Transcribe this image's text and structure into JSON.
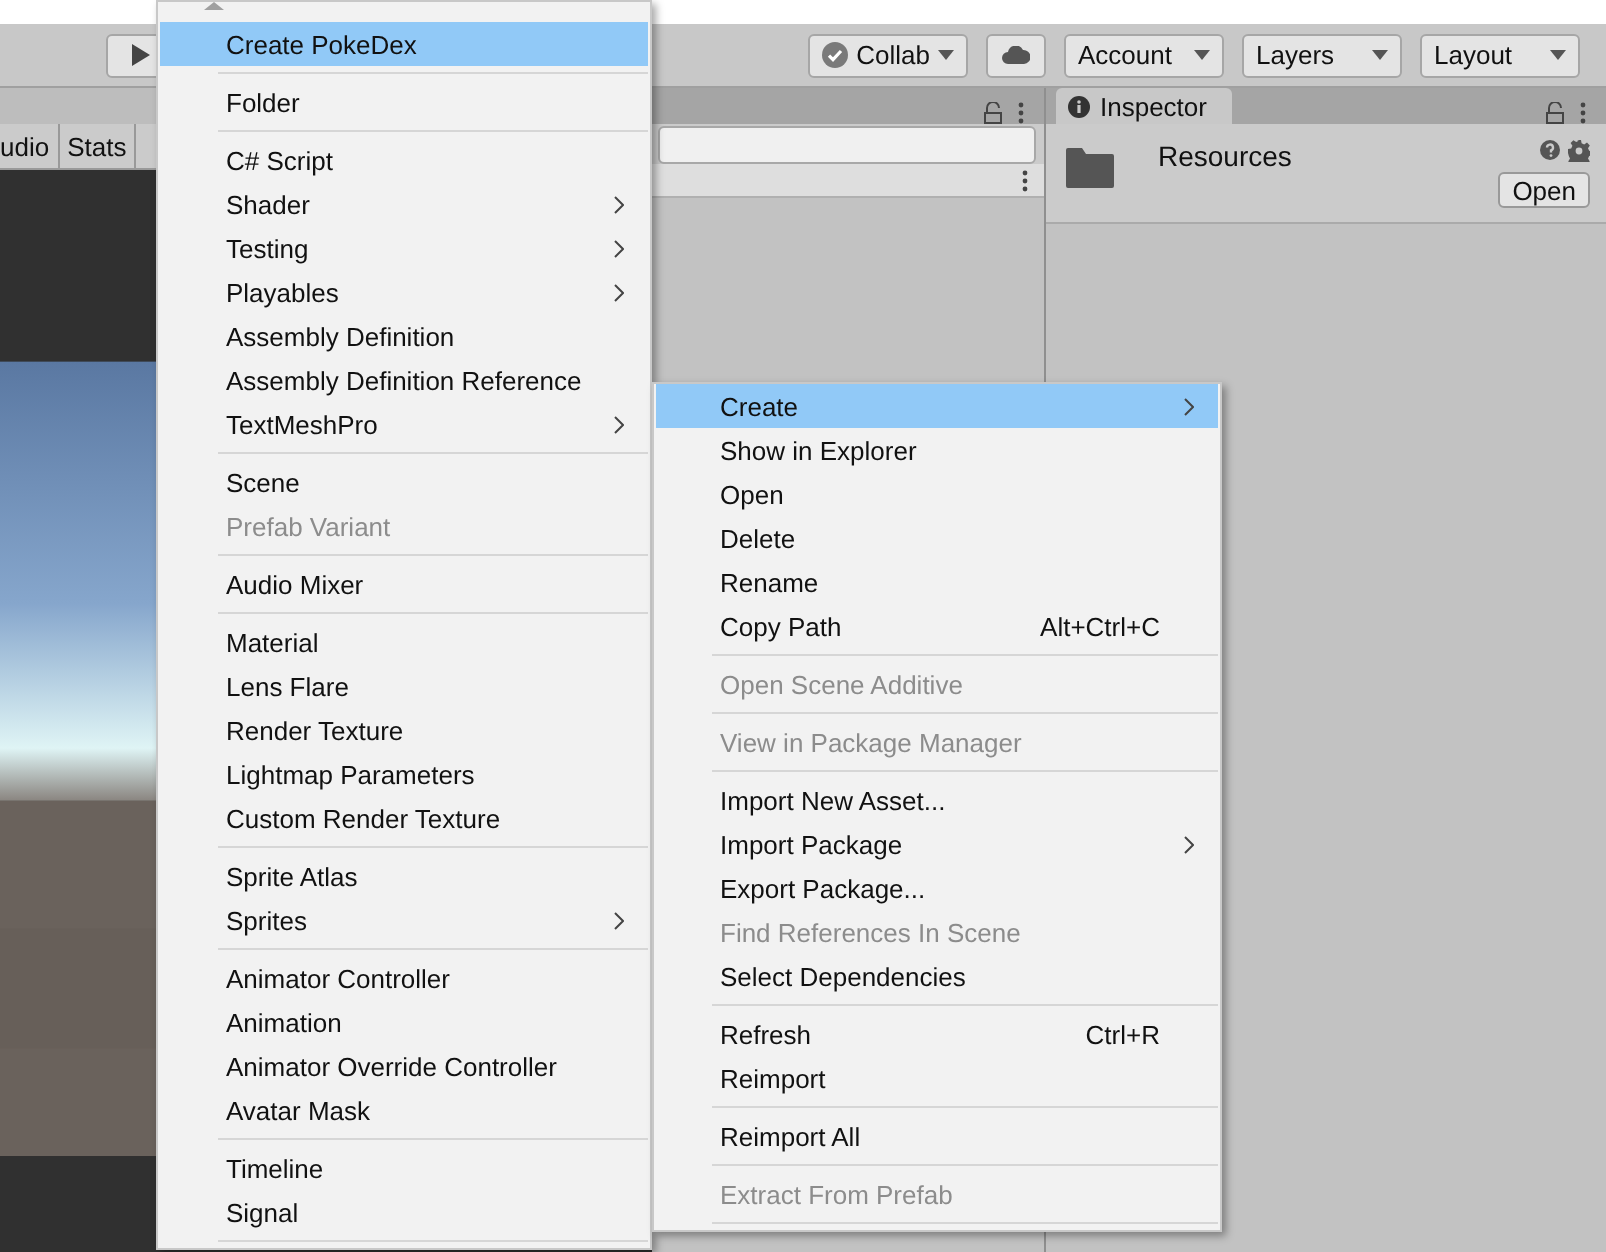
{
  "toolbar": {
    "buttons": [
      {
        "kind": "collab",
        "label": "Collab"
      },
      {
        "kind": "cloud"
      },
      {
        "kind": "dropdown",
        "label": "Account"
      },
      {
        "kind": "dropdown",
        "label": "Layers"
      },
      {
        "kind": "dropdown",
        "label": "Layout"
      }
    ]
  },
  "game_panel": {
    "toolbar_buttons": [
      "udio",
      "Stats"
    ]
  },
  "inspector": {
    "tab": "Inspector",
    "asset_name": "Resources",
    "open_button": "Open"
  },
  "create_menu": {
    "items": [
      {
        "kind": "item",
        "label": "Create PokeDex",
        "selected": true,
        "disabled": false,
        "submenu": false
      },
      {
        "kind": "separator"
      },
      {
        "kind": "item",
        "label": "Folder",
        "selected": false,
        "disabled": false,
        "submenu": false
      },
      {
        "kind": "separator"
      },
      {
        "kind": "item",
        "label": "C# Script",
        "selected": false,
        "disabled": false,
        "submenu": false
      },
      {
        "kind": "item",
        "label": "Shader",
        "selected": false,
        "disabled": false,
        "submenu": true
      },
      {
        "kind": "item",
        "label": "Testing",
        "selected": false,
        "disabled": false,
        "submenu": true
      },
      {
        "kind": "item",
        "label": "Playables",
        "selected": false,
        "disabled": false,
        "submenu": true
      },
      {
        "kind": "item",
        "label": "Assembly Definition",
        "selected": false,
        "disabled": false,
        "submenu": false
      },
      {
        "kind": "item",
        "label": "Assembly Definition Reference",
        "selected": false,
        "disabled": false,
        "submenu": false
      },
      {
        "kind": "item",
        "label": "TextMeshPro",
        "selected": false,
        "disabled": false,
        "submenu": true
      },
      {
        "kind": "separator"
      },
      {
        "kind": "item",
        "label": "Scene",
        "selected": false,
        "disabled": false,
        "submenu": false
      },
      {
        "kind": "item",
        "label": "Prefab Variant",
        "selected": false,
        "disabled": true,
        "submenu": false
      },
      {
        "kind": "separator"
      },
      {
        "kind": "item",
        "label": "Audio Mixer",
        "selected": false,
        "disabled": false,
        "submenu": false
      },
      {
        "kind": "separator"
      },
      {
        "kind": "item",
        "label": "Material",
        "selected": false,
        "disabled": false,
        "submenu": false
      },
      {
        "kind": "item",
        "label": "Lens Flare",
        "selected": false,
        "disabled": false,
        "submenu": false
      },
      {
        "kind": "item",
        "label": "Render Texture",
        "selected": false,
        "disabled": false,
        "submenu": false
      },
      {
        "kind": "item",
        "label": "Lightmap Parameters",
        "selected": false,
        "disabled": false,
        "submenu": false
      },
      {
        "kind": "item",
        "label": "Custom Render Texture",
        "selected": false,
        "disabled": false,
        "submenu": false
      },
      {
        "kind": "separator"
      },
      {
        "kind": "item",
        "label": "Sprite Atlas",
        "selected": false,
        "disabled": false,
        "submenu": false
      },
      {
        "kind": "item",
        "label": "Sprites",
        "selected": false,
        "disabled": false,
        "submenu": true
      },
      {
        "kind": "separator"
      },
      {
        "kind": "item",
        "label": "Animator Controller",
        "selected": false,
        "disabled": false,
        "submenu": false
      },
      {
        "kind": "item",
        "label": "Animation",
        "selected": false,
        "disabled": false,
        "submenu": false
      },
      {
        "kind": "item",
        "label": "Animator Override Controller",
        "selected": false,
        "disabled": false,
        "submenu": false
      },
      {
        "kind": "item",
        "label": "Avatar Mask",
        "selected": false,
        "disabled": false,
        "submenu": false
      },
      {
        "kind": "separator"
      },
      {
        "kind": "item",
        "label": "Timeline",
        "selected": false,
        "disabled": false,
        "submenu": false
      },
      {
        "kind": "item",
        "label": "Signal",
        "selected": false,
        "disabled": false,
        "submenu": false
      },
      {
        "kind": "separator"
      }
    ]
  },
  "context_menu": {
    "items": [
      {
        "kind": "item",
        "label": "Create",
        "selected": true,
        "disabled": false,
        "submenu": true
      },
      {
        "kind": "item",
        "label": "Show in Explorer",
        "selected": false,
        "disabled": false,
        "submenu": false
      },
      {
        "kind": "item",
        "label": "Open",
        "selected": false,
        "disabled": false,
        "submenu": false
      },
      {
        "kind": "item",
        "label": "Delete",
        "selected": false,
        "disabled": false,
        "submenu": false
      },
      {
        "kind": "item",
        "label": "Rename",
        "selected": false,
        "disabled": false,
        "submenu": false
      },
      {
        "kind": "item",
        "label": "Copy Path",
        "selected": false,
        "disabled": false,
        "submenu": false,
        "shortcut": "Alt+Ctrl+C"
      },
      {
        "kind": "separator"
      },
      {
        "kind": "item",
        "label": "Open Scene Additive",
        "selected": false,
        "disabled": true,
        "submenu": false
      },
      {
        "kind": "separator"
      },
      {
        "kind": "item",
        "label": "View in Package Manager",
        "selected": false,
        "disabled": true,
        "submenu": false
      },
      {
        "kind": "separator"
      },
      {
        "kind": "item",
        "label": "Import New Asset...",
        "selected": false,
        "disabled": false,
        "submenu": false
      },
      {
        "kind": "item",
        "label": "Import Package",
        "selected": false,
        "disabled": false,
        "submenu": true
      },
      {
        "kind": "item",
        "label": "Export Package...",
        "selected": false,
        "disabled": false,
        "submenu": false
      },
      {
        "kind": "item",
        "label": "Find References In Scene",
        "selected": false,
        "disabled": true,
        "submenu": false
      },
      {
        "kind": "item",
        "label": "Select Dependencies",
        "selected": false,
        "disabled": false,
        "submenu": false
      },
      {
        "kind": "separator"
      },
      {
        "kind": "item",
        "label": "Refresh",
        "selected": false,
        "disabled": false,
        "submenu": false,
        "shortcut": "Ctrl+R"
      },
      {
        "kind": "item",
        "label": "Reimport",
        "selected": false,
        "disabled": false,
        "submenu": false
      },
      {
        "kind": "separator"
      },
      {
        "kind": "item",
        "label": "Reimport All",
        "selected": false,
        "disabled": false,
        "submenu": false
      },
      {
        "kind": "separator"
      },
      {
        "kind": "item",
        "label": "Extract From Prefab",
        "selected": false,
        "disabled": true,
        "submenu": false
      },
      {
        "kind": "separator"
      }
    ]
  }
}
